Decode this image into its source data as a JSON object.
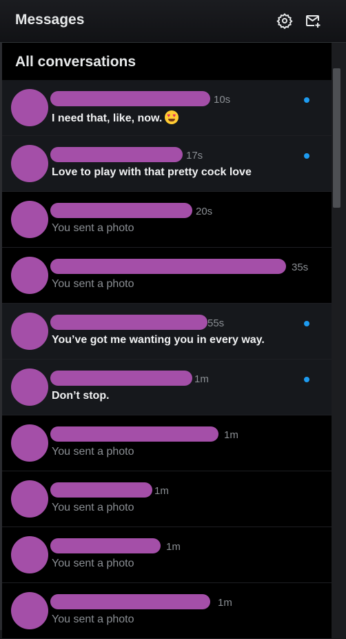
{
  "header": {
    "title": "Messages",
    "settings_icon": "gear-icon",
    "compose_icon": "new-message-icon"
  },
  "section": {
    "title": "All conversations"
  },
  "conversations": [
    {
      "time": "10s",
      "preview": "I need that, like, now.",
      "emoji": "heart-eyes-emoji",
      "unread": true
    },
    {
      "time": "17s",
      "preview": "Love to play with that pretty cock love",
      "unread": true
    },
    {
      "time": "20s",
      "preview": "You sent a photo",
      "unread": false
    },
    {
      "time": "35s",
      "preview": "You sent a photo",
      "unread": false
    },
    {
      "time": "55s",
      "preview": "You’ve got me wanting you in every way.",
      "unread": true
    },
    {
      "time": "1m",
      "preview": "Don’t stop.",
      "unread": true
    },
    {
      "time": "1m",
      "preview": "You sent a photo",
      "unread": false
    },
    {
      "time": "1m",
      "preview": "You sent a photo",
      "unread": false
    },
    {
      "time": "1m",
      "preview": "You sent a photo",
      "unread": false
    },
    {
      "time": "1m",
      "preview": "You sent a photo",
      "unread": false
    }
  ],
  "colors": {
    "accent": "#1d9bf0",
    "redaction": "#a44fa8"
  }
}
